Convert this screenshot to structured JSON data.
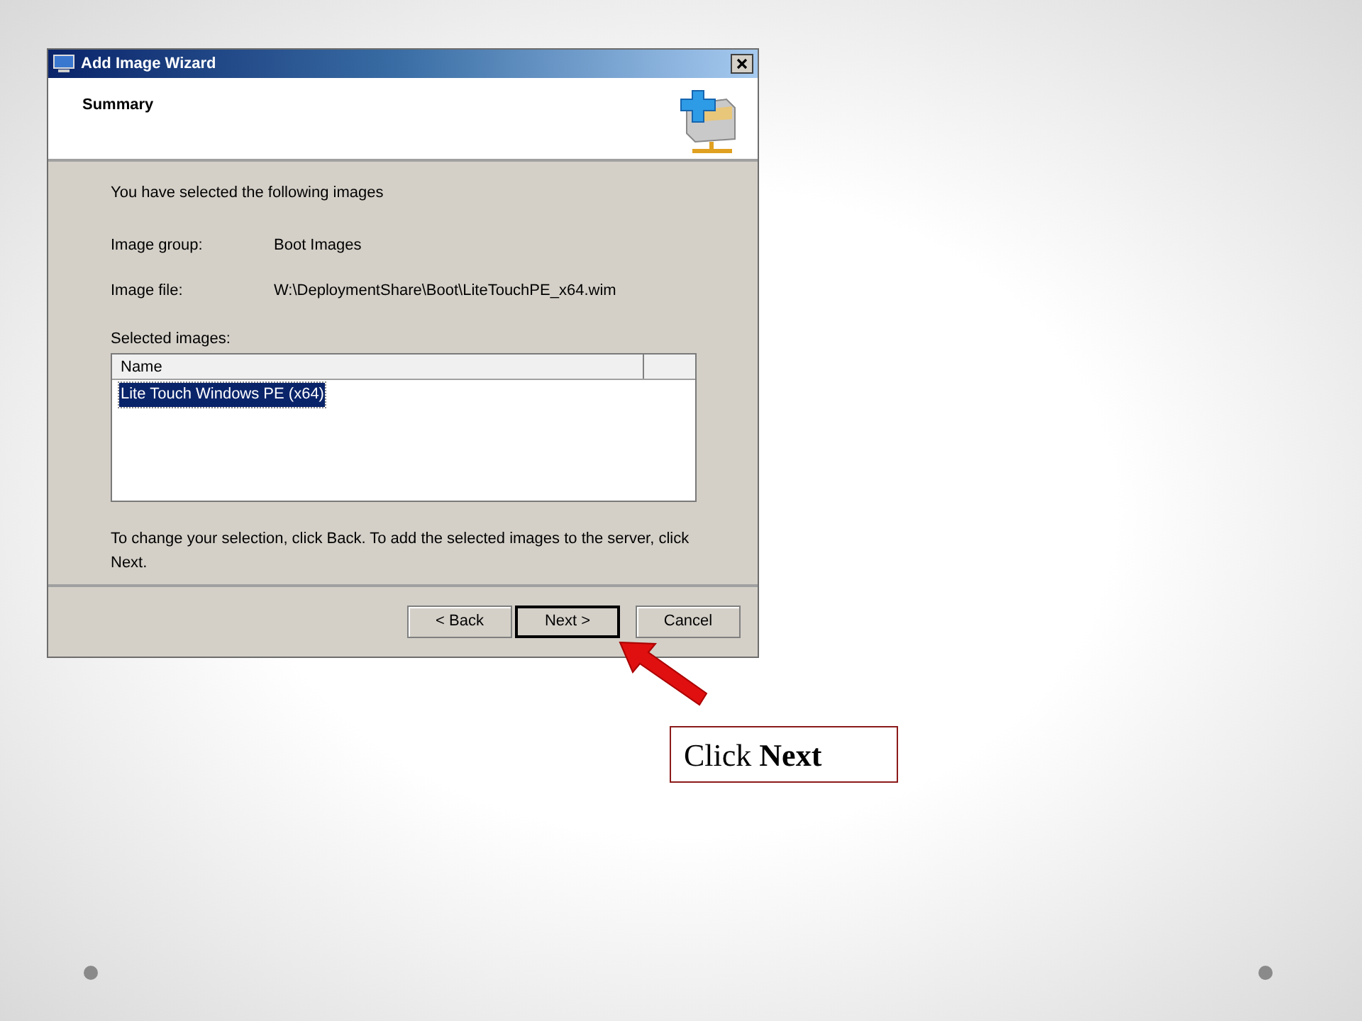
{
  "window": {
    "title": "Add Image Wizard"
  },
  "header": {
    "title": "Summary"
  },
  "intro": "You have selected the following images",
  "fields": [
    {
      "label": "Image group:",
      "value": "Boot Images"
    },
    {
      "label": "Image file:",
      "value": "W:\\DeploymentShare\\Boot\\LiteTouchPE_x64.wim"
    }
  ],
  "list": {
    "label": "Selected images:",
    "columns": [
      "Name"
    ],
    "rows": [
      {
        "name": "Lite Touch Windows PE (x64)",
        "selected": true
      }
    ]
  },
  "instructions": "To change your selection, click Back. To add the selected images to the server, click Next.",
  "buttons": [
    {
      "label": "< Back",
      "default": false
    },
    {
      "label": "Next >",
      "default": true
    },
    {
      "label": "Cancel",
      "default": false
    }
  ],
  "callout": "Click **Next**"
}
